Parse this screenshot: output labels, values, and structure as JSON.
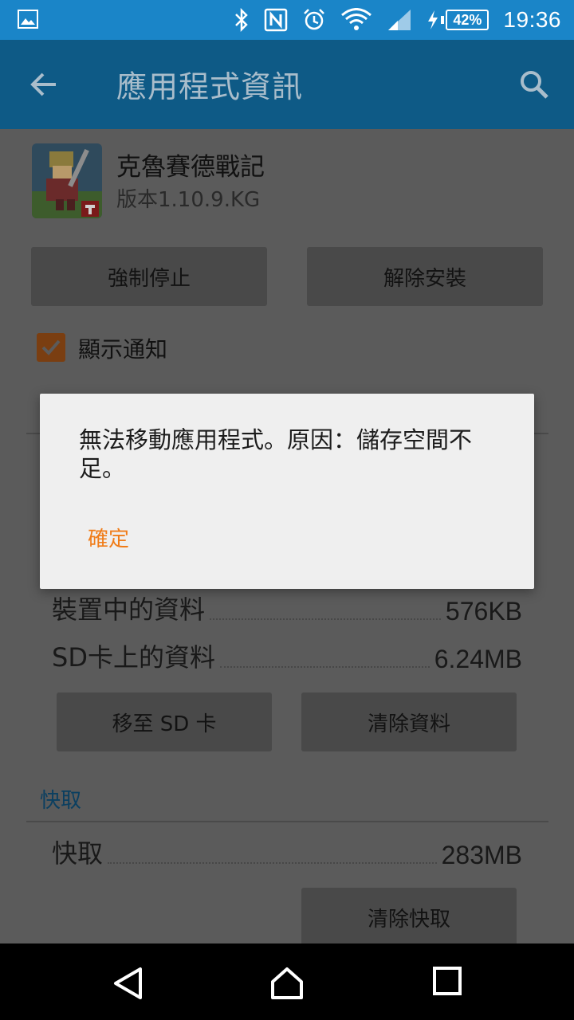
{
  "status_bar": {
    "time": "19:36",
    "battery_percent": "42%",
    "icons": [
      "image-notification-icon",
      "bluetooth-icon",
      "nfc-icon",
      "alarm-icon",
      "wifi-icon",
      "signal-icon",
      "charging-icon",
      "battery-icon"
    ]
  },
  "app_bar": {
    "title": "應用程式資訊",
    "back_icon": "arrow-back-icon",
    "search_icon": "search-icon"
  },
  "app": {
    "name": "克魯賽德戰記",
    "version": "版本1.10.9.KG"
  },
  "actions": {
    "force_stop": "強制停止",
    "uninstall": "解除安裝"
  },
  "notifications": {
    "label": "顯示通知",
    "checked": true
  },
  "storage": {
    "rows": [
      {
        "label": "裝置中的資料",
        "value": "576KB"
      },
      {
        "label": "SD卡上的資料",
        "value": "6.24MB"
      }
    ],
    "move_sd": "移至 SD 卡",
    "clear_data": "清除資料"
  },
  "cache": {
    "header": "快取",
    "row": {
      "label": "快取",
      "value": "283MB"
    },
    "clear_cache": "清除快取"
  },
  "dialog": {
    "message": "無法移動應用程式。原因：儲存空間不足。",
    "ok": "確定"
  },
  "nav": {
    "icons": [
      "back-nav-icon",
      "home-nav-icon",
      "recents-nav-icon"
    ]
  },
  "colors": {
    "status_bar": "#1a85c8",
    "app_bar_dimmed": "#0e5a86",
    "dialog_accent": "#f07c18",
    "section_header": "#0b3f60"
  }
}
